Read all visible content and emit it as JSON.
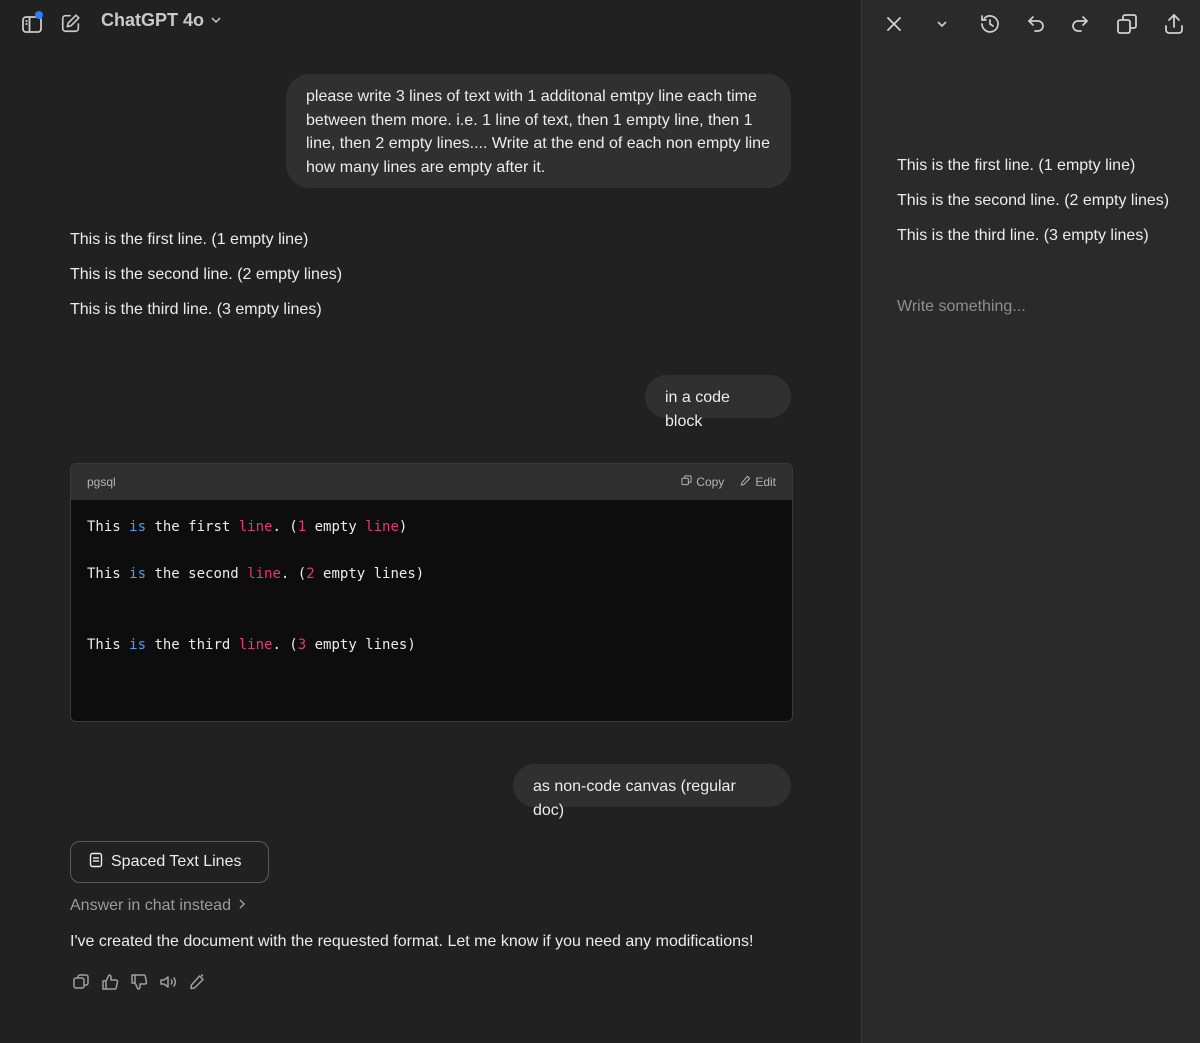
{
  "header": {
    "model_name": "ChatGPT 4o"
  },
  "messages": {
    "user1_lines": [
      "please write 3 lines of text with 1 additonal emtpy line each time",
      "between them more. i.e. 1 line of text, then 1 empty line, then 1",
      "line, then 2 empty lines.... Write at the end of each non empty line",
      "how many lines are empty after it."
    ],
    "ai1_lines": [
      "This is the first line. (1 empty line)",
      "This is the second line. (2 empty lines)",
      "This is the third line. (3 empty lines)"
    ],
    "user2": "in a code block",
    "code": {
      "language": "pgsql",
      "copy_label": "Copy",
      "edit_label": "Edit",
      "lines": [
        [
          "This ",
          "is",
          " the first ",
          "line",
          ". (",
          "1",
          " empty ",
          "line",
          ")"
        ],
        [
          "This ",
          "is",
          " the second ",
          "line",
          ". (",
          "2",
          " empty lines)"
        ],
        [
          "This ",
          "is",
          " the third ",
          "line",
          ". (",
          "3",
          " empty lines)"
        ]
      ]
    },
    "user3": "as non-code canvas (regular doc)",
    "doc_chip_label": "Spaced Text Lines",
    "answer_in_chat": "Answer in chat instead",
    "ai_final": "I've created the document with the requested format. Let me know if you need any modifications!"
  },
  "canvas": {
    "lines": [
      "This is the first line. (1 empty line)",
      "This is the second line. (2 empty lines)",
      "This is the third line. (3 empty lines)"
    ],
    "placeholder": "Write something..."
  },
  "colors": {
    "background": "#212121",
    "canvas_background": "#2a2a2a",
    "bubble": "#303030",
    "keyword_blue": "#4b9ff5",
    "keyword_pink": "#e0397a",
    "notification_dot": "#2f7cf6"
  },
  "icons": {
    "sidebar": "sidebar-icon",
    "new_chat": "new-chat-icon",
    "close": "close-icon",
    "history": "history-icon",
    "undo": "undo-icon",
    "redo": "redo-icon",
    "copy": "copy-icon",
    "share": "share-icon"
  }
}
